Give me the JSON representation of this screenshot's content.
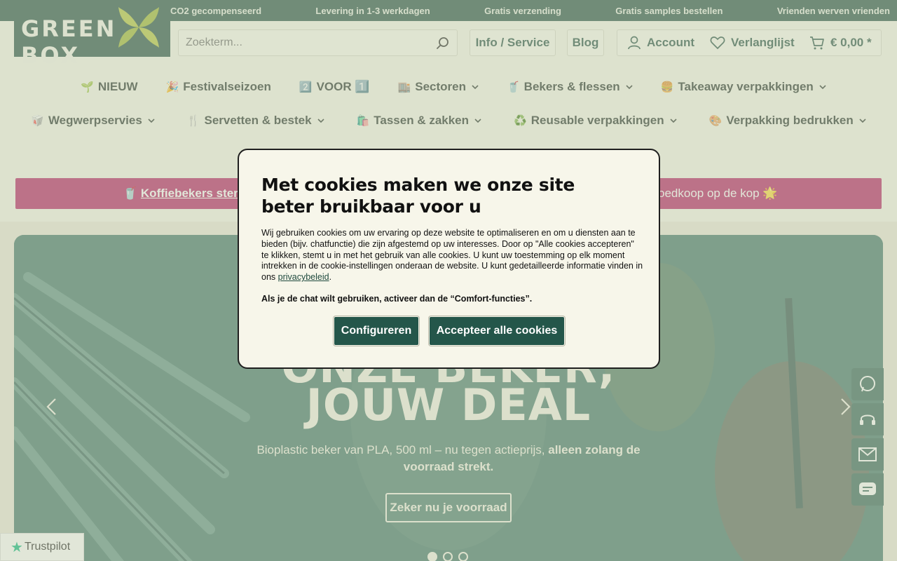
{
  "topbar": {
    "items": [
      "CO2 gecompenseerd",
      "Levering in 1-3 werkdagen",
      "Gratis verzending",
      "Gratis samples bestellen",
      "Vrienden werven vrienden"
    ]
  },
  "logo": {
    "text": "GREEN BOX"
  },
  "search": {
    "placeholder": "Zoekterm..."
  },
  "header": {
    "info_label": "Info / Service",
    "blog_label": "Blog",
    "account_label": "Account",
    "wishlist_label": "Verlanglijst",
    "cart_label": "€ 0,00 *"
  },
  "nav": {
    "row1": [
      {
        "emoji": "🌱",
        "label": "NIEUW",
        "dropdown": false
      },
      {
        "emoji": "🎉",
        "label": "Festivalseizoen",
        "dropdown": false
      },
      {
        "emoji": "2️⃣",
        "label": "VOOR 1️⃣",
        "dropdown": false
      },
      {
        "emoji": "🏬",
        "label": "Sectoren",
        "dropdown": true
      },
      {
        "emoji": "🥤",
        "label": "Bekers & flessen",
        "dropdown": true
      },
      {
        "emoji": "🍔",
        "label": "Takeaway verpakkingen",
        "dropdown": true
      }
    ],
    "row2": [
      {
        "emoji": "🥡",
        "label": "Wegwerpservies",
        "dropdown": true
      },
      {
        "emoji": "🍴",
        "label": "Servetten & bestek",
        "dropdown": true
      },
      {
        "emoji": "🛍️",
        "label": "Tassen & zakken",
        "dropdown": true
      },
      {
        "emoji": "♻️",
        "label": "Reusable verpakkingen",
        "dropdown": true
      },
      {
        "emoji": "🎨",
        "label": "Verpakking bedrukken",
        "dropdown": true
      }
    ]
  },
  "promo": {
    "left_emoji": "🥤",
    "left_link": "Koffiebekers sterk",
    "right_text": "oedkoop op de kop 🌟"
  },
  "hero": {
    "title_line1": "ONZE BEKER,",
    "title_line2": "JOUW DEAL",
    "subtitle_plain": "Bioplastic beker van PLA, 500 ml – nu tegen actieprijs,",
    "subtitle_bold": "alleen zolang de voorraad strekt.",
    "cta": "Zeker nu je voorraad",
    "slides": 3,
    "active_slide": 1
  },
  "trustpilot": {
    "label": "Trustpilot"
  },
  "cookie": {
    "title": "Met cookies maken we onze site beter bruikbaar voor u",
    "text": "Wij gebruiken cookies om uw ervaring op deze website te optimaliseren en om u diensten aan te bieden (bijv. chatfunctie) die zijn afgestemd op uw interesses. Door op \"Alle cookies accepteren\" te klikken, stemt u in met het gebruik van alle cookies. U kunt uw toestemming op elk moment intrekken in de cookie-instellingen onderaan de website. U kunt gedetailleerde informatie vinden in ons",
    "link": "privacybeleid",
    "note": "Als je de chat wilt gebruiken, activeer dan de “Comfort-functies”.",
    "configure_label": "Configureren",
    "accept_label": "Accepteer alle cookies"
  },
  "colors": {
    "brand_green": "#1f4a3e",
    "promo_magenta": "#b5165f",
    "button_green": "#24564a",
    "background": "#f7f6ea"
  }
}
